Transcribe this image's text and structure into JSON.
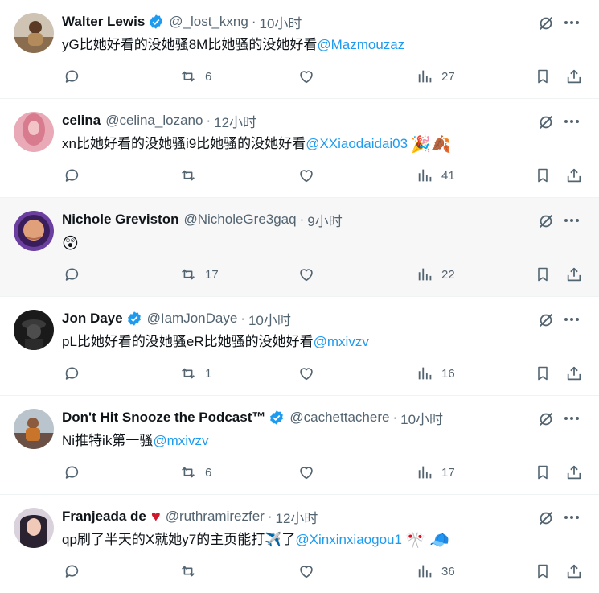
{
  "colors": {
    "accent": "#1d9bf0",
    "muted": "#536471",
    "verified": "#1d9bf0",
    "heart": "#d0182c"
  },
  "tweets": [
    {
      "name": "Walter Lewis",
      "verified": true,
      "handle": "@_lost_kxng",
      "time": "10小时",
      "text": "yG比她好看的没她骚8M比她骚的没她好看",
      "mention": "@Mazmouzaz",
      "emoji": "",
      "replies": "",
      "retweets": "6",
      "likes": "",
      "views": "27"
    },
    {
      "name": "celina",
      "verified": false,
      "handle": "@celina_lozano",
      "time": "12小时",
      "text": "xn比她好看的没她骚i9比她骚的没她好看",
      "mention": "@XXiaodaidai03",
      "emoji": "🎉🍂",
      "replies": "",
      "retweets": "",
      "likes": "",
      "views": "41"
    },
    {
      "name": "Nichole Greviston",
      "verified": false,
      "handle": "@NicholeGre3gaq",
      "time": "9小时",
      "text": "",
      "mention": "",
      "emoji": "😲",
      "replies": "",
      "retweets": "17",
      "likes": "",
      "views": "22"
    },
    {
      "name": "Jon Daye",
      "verified": true,
      "handle": "@IamJonDaye",
      "time": "10小时",
      "text": "pL比她好看的没她骚eR比她骚的没她好看",
      "mention": "@mxivzv",
      "emoji": "",
      "replies": "",
      "retweets": "1",
      "likes": "",
      "views": "16"
    },
    {
      "name": "Don't Hit Snooze the Podcast™",
      "verified": true,
      "handle": "@cachettachere",
      "time": "10小时",
      "text": "Ni推特ik第一骚",
      "mention": "@mxivzv",
      "emoji": "",
      "replies": "",
      "retweets": "6",
      "likes": "",
      "views": "17"
    },
    {
      "name": "Franjeada de",
      "verified": false,
      "heart": "♥",
      "handle": "@ruthramirezfer",
      "time": "12小时",
      "text": "qp刷了半天的X就她y7的主页能打✈️了",
      "mention": "@Xinxinxiaogou1",
      "emoji": "🎌 🧢",
      "replies": "",
      "retweets": "",
      "likes": "",
      "views": "36"
    }
  ],
  "separator": "·",
  "icons": [
    "verified-badge-icon",
    "grok-icon",
    "more-icon",
    "reply-icon",
    "retweet-icon",
    "like-icon",
    "views-icon",
    "bookmark-icon",
    "share-icon"
  ]
}
